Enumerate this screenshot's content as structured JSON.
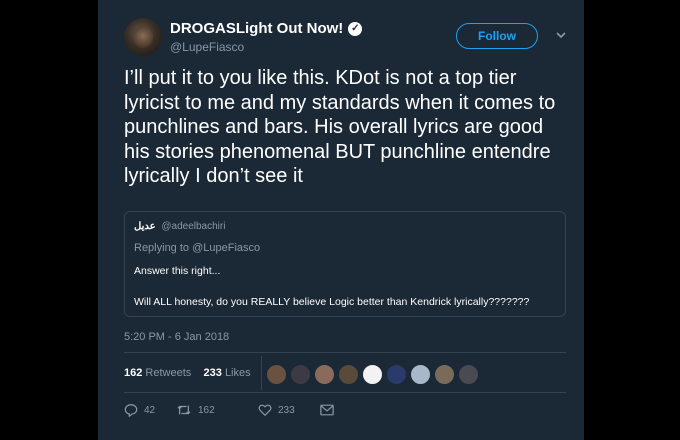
{
  "tweet": {
    "display_name": "DROGASLight Out Now!",
    "handle": "@LupeFiasco",
    "follow_label": "Follow",
    "text": "I’ll put it to you like this. KDot is not a top tier lyricist to me and my standards when it comes to punchlines and bars. His overall lyrics are good his stories phenomenal BUT punchline entendre lyrically I don’t see it",
    "timestamp": "5:20 PM - 6 Jan 2018"
  },
  "quoted_tweet": {
    "author_name": "عديل",
    "author_handle": "@adeelbachiri",
    "replying_to": "Replying to @LupeFiasco",
    "line1": "Answer this right...",
    "line2": "Will ALL honesty, do you REALLY believe Logic better than Kendrick lyrically???????"
  },
  "stats": {
    "retweets_count": "162",
    "retweets_label": "Retweets",
    "likes_count": "233",
    "likes_label": "Likes"
  },
  "liker_avatars": [
    {
      "color": "#6b5140"
    },
    {
      "color": "#3d3a45"
    },
    {
      "color": "#8a6a5a"
    },
    {
      "color": "#5a4a3a"
    },
    {
      "color": "#f2f2f2"
    },
    {
      "color": "#2a3a6a"
    },
    {
      "color": "#a9b8c8"
    },
    {
      "color": "#7a6a5a"
    },
    {
      "color": "#4a4a52"
    }
  ],
  "actions": {
    "reply_count": "42",
    "retweet_count": "162",
    "like_count": "233"
  },
  "colors": {
    "background": "#1b2836",
    "accent": "#1da1f2",
    "secondary_text": "#8899a6",
    "border": "#38444d"
  }
}
